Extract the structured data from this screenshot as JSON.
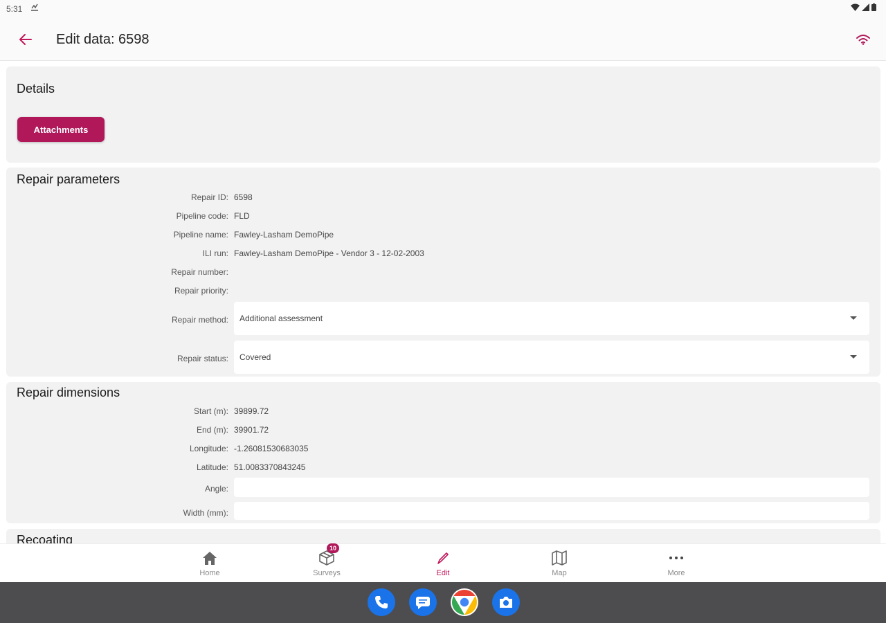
{
  "status_bar": {
    "time": "5:31"
  },
  "app_bar": {
    "title": "Edit data: 6598"
  },
  "details": {
    "title": "Details",
    "attachments_button": "Attachments"
  },
  "repair_parameters": {
    "title": "Repair parameters",
    "rows": [
      {
        "label": "Repair ID:",
        "value": "6598"
      },
      {
        "label": "Pipeline code:",
        "value": "FLD"
      },
      {
        "label": "Pipeline name:",
        "value": "Fawley-Lasham DemoPipe"
      },
      {
        "label": "ILI run:",
        "value": "Fawley-Lasham DemoPipe - Vendor 3 - 12-02-2003"
      },
      {
        "label": "Repair number:",
        "value": ""
      },
      {
        "label": "Repair priority:",
        "value": ""
      }
    ],
    "repair_method": {
      "label": "Repair method:",
      "value": "Additional assessment"
    },
    "repair_status": {
      "label": "Repair status:",
      "value": "Covered"
    }
  },
  "repair_dimensions": {
    "title": "Repair dimensions",
    "rows": [
      {
        "label": "Start (m):",
        "value": "39899.72"
      },
      {
        "label": "End (m):",
        "value": "39901.72"
      },
      {
        "label": "Longitude:",
        "value": "-1.26081530683035"
      },
      {
        "label": "Latitude:",
        "value": "51.0083370843245"
      }
    ],
    "angle": {
      "label": "Angle:",
      "value": ""
    },
    "width": {
      "label": "Width (mm):",
      "value": ""
    }
  },
  "recoating": {
    "title": "Recoating"
  },
  "bottom_nav": {
    "items": [
      {
        "label": "Home",
        "icon": "home-icon"
      },
      {
        "label": "Surveys",
        "icon": "package-icon",
        "badge": "10"
      },
      {
        "label": "Edit",
        "icon": "pencil-icon",
        "active": true
      },
      {
        "label": "Map",
        "icon": "map-icon"
      },
      {
        "label": "More",
        "icon": "more-horizontal-icon"
      }
    ]
  },
  "dock": {
    "apps": [
      "phone-icon",
      "messages-icon",
      "chrome-icon",
      "camera-icon"
    ]
  },
  "colors": {
    "accent": "#b0185a",
    "card_bg": "#f2f2f2",
    "os_nav": "#4d4d4f"
  }
}
